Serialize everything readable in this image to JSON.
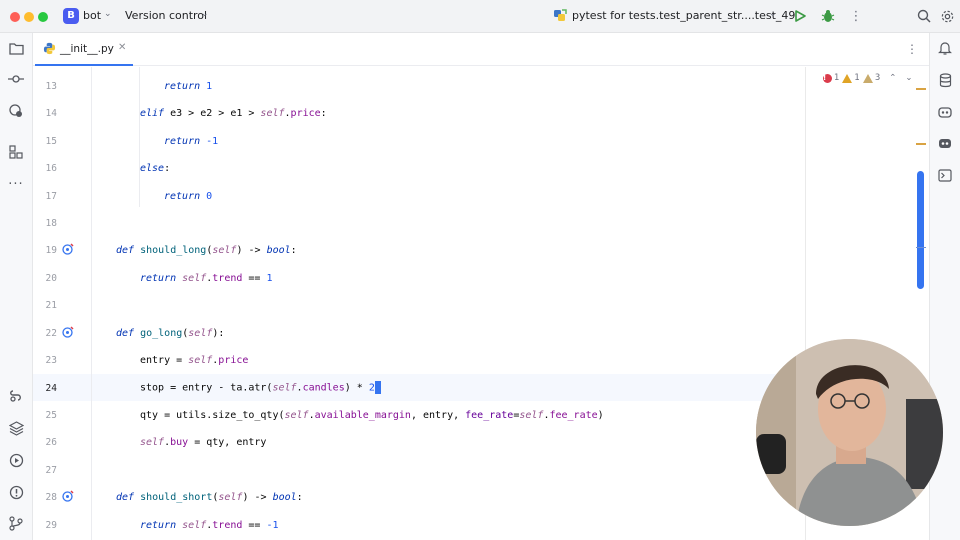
{
  "titlebar": {
    "project_badge": "B",
    "project_name": "bot",
    "vcs_label": "Version control",
    "run_config": "pytest for tests.test_parent_str....test_49"
  },
  "tabs": [
    {
      "label": "__init__.py",
      "active": true
    }
  ],
  "inspections": {
    "errors": "1",
    "warnings": "1",
    "weak_warnings": "3"
  },
  "editor": {
    "current_line": "24",
    "line_numbers": [
      "13",
      "14",
      "15",
      "16",
      "17",
      "18",
      "19",
      "20",
      "21",
      "22",
      "23",
      "24",
      "25",
      "26",
      "27",
      "28",
      "29"
    ],
    "accent_color": "#3574f0"
  },
  "colors": {
    "keyword": "#0033b3",
    "self": "#94558d",
    "number": "#1750eb",
    "function_name": "#00627a",
    "attribute": "#871094",
    "caret": "#3574f0"
  },
  "code": {
    "l13_return": "return",
    "l13_val": "1",
    "l14_elif": "elif",
    "l14_a": " e3 > e2 > e1 > ",
    "l14_self": "self",
    "l14_b": ".",
    "l14_attr": "price",
    "l14_c": ":",
    "l15_return": "return",
    "l15_val": "-1",
    "l16_else": "else",
    "l16_c": ":",
    "l17_return": "return",
    "l17_val": "0",
    "l19_def": "def",
    "l19_name": "should_long",
    "l19_a": "(",
    "l19_self": "self",
    "l19_b": ") -> ",
    "l19_type": "bool",
    "l19_c": ":",
    "l20_return": "return",
    "l20_self": "self",
    "l20_a": ".",
    "l20_attr": "trend",
    "l20_b": " == ",
    "l20_val": "1",
    "l22_def": "def",
    "l22_name": "go_long",
    "l22_a": "(",
    "l22_self": "self",
    "l22_b": "):",
    "l23_a": "entry = ",
    "l23_self": "self",
    "l23_b": ".",
    "l23_attr": "price",
    "l24_a": "stop = entry - ta.atr(",
    "l24_self": "self",
    "l24_b": ".",
    "l24_attr": "candles",
    "l24_c": ") * ",
    "l24_val": "2",
    "l25_a": "qty = utils.size_to_qty(",
    "l25_self": "self",
    "l25_b": ".",
    "l25_attr": "available_margin",
    "l25_c": ", entry, ",
    "l25_kw": "fee_rate",
    "l25_d": "=",
    "l25_self2": "self",
    "l25_e": ".",
    "l25_attr2": "fee_rate",
    "l25_f": ")",
    "l26_self": "self",
    "l26_a": ".",
    "l26_attr": "buy",
    "l26_b": " = qty, entry",
    "l28_def": "def",
    "l28_name": "should_short",
    "l28_a": "(",
    "l28_self": "self",
    "l28_b": ") -> ",
    "l28_type": "bool",
    "l28_c": ":",
    "l29_return": "return",
    "l29_self": "self",
    "l29_a": ".",
    "l29_attr": "trend",
    "l29_b": " == ",
    "l29_val": "-1"
  },
  "icons": {
    "left": [
      "folder-icon",
      "commit-icon",
      "python-packages-icon",
      "structure-icon",
      "more-icon",
      "python-console-icon",
      "layers-icon",
      "run-services-icon",
      "problems-icon",
      "git-icon"
    ],
    "right": [
      "notifications-icon",
      "database-icon",
      "ai-assistant-icon",
      "copilot-icon",
      "terminal-icon"
    ]
  }
}
